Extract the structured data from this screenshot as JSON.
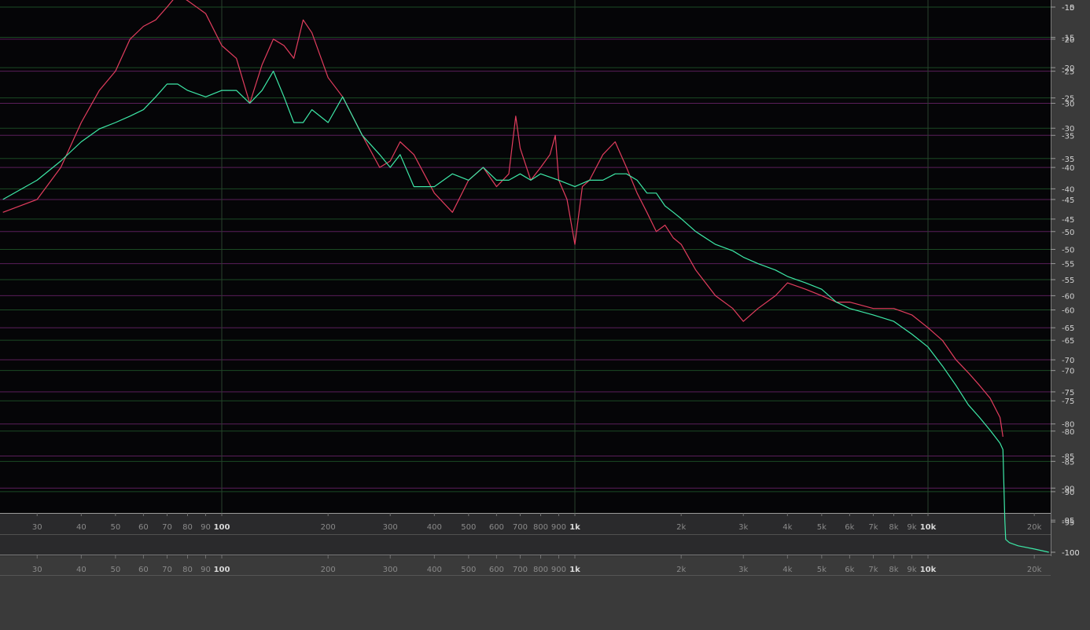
{
  "chart_data": {
    "type": "line",
    "xscale": "log",
    "xlim": [
      24,
      24000
    ],
    "grid": true,
    "legend": "none",
    "x_tick_labels": [
      "30",
      "40",
      "50",
      "60",
      "70",
      "80",
      "90",
      "100",
      "200",
      "300",
      "400",
      "500",
      "600",
      "700",
      "800",
      "900",
      "1k",
      "2k",
      "3k",
      "4k",
      "5k",
      "6k",
      "7k",
      "8k",
      "9k",
      "10k",
      "20k"
    ],
    "major_ticks": [
      "100",
      "1k",
      "10k"
    ],
    "left_scale": {
      "ylim": [
        -100,
        -15
      ],
      "labels": [
        "-15",
        "-20",
        "-25",
        "-30",
        "-35",
        "-40",
        "-45",
        "-50",
        "-55",
        "-60",
        "-65",
        "-70",
        "-75",
        "-80",
        "-85",
        "-90",
        "-95",
        "-100"
      ]
    },
    "right_scale": {
      "ylim": [
        -100,
        -10
      ],
      "labels": [
        "-10",
        "-15",
        "-20",
        "-25",
        "-30",
        "-35",
        "-40",
        "-45",
        "-50",
        "-55",
        "-60",
        "-65",
        "-70",
        "-75",
        "-80",
        "-85",
        "-90",
        "-95",
        "-100"
      ]
    },
    "series": [
      {
        "color": "#e23d5e",
        "points": [
          [
            24,
            -47
          ],
          [
            30,
            -45
          ],
          [
            35,
            -40
          ],
          [
            40,
            -33
          ],
          [
            45,
            -28
          ],
          [
            50,
            -25
          ],
          [
            55,
            -20
          ],
          [
            60,
            -18
          ],
          [
            65,
            -17
          ],
          [
            70,
            -15
          ],
          [
            75,
            -13
          ],
          [
            80,
            -14
          ],
          [
            90,
            -16
          ],
          [
            100,
            -21
          ],
          [
            110,
            -23
          ],
          [
            120,
            -30
          ],
          [
            130,
            -24
          ],
          [
            140,
            -20
          ],
          [
            150,
            -21
          ],
          [
            160,
            -23
          ],
          [
            170,
            -17
          ],
          [
            180,
            -19
          ],
          [
            200,
            -26
          ],
          [
            220,
            -29
          ],
          [
            250,
            -35
          ],
          [
            280,
            -40
          ],
          [
            300,
            -39
          ],
          [
            320,
            -36
          ],
          [
            350,
            -38
          ],
          [
            400,
            -44
          ],
          [
            450,
            -47
          ],
          [
            500,
            -42
          ],
          [
            550,
            -40
          ],
          [
            600,
            -43
          ],
          [
            650,
            -41
          ],
          [
            680,
            -32
          ],
          [
            700,
            -37
          ],
          [
            750,
            -42
          ],
          [
            800,
            -40
          ],
          [
            850,
            -38
          ],
          [
            880,
            -35
          ],
          [
            900,
            -42
          ],
          [
            950,
            -45
          ],
          [
            1000,
            -52
          ],
          [
            1050,
            -43
          ],
          [
            1100,
            -42
          ],
          [
            1200,
            -38
          ],
          [
            1300,
            -36
          ],
          [
            1400,
            -40
          ],
          [
            1500,
            -44
          ],
          [
            1600,
            -47
          ],
          [
            1700,
            -50
          ],
          [
            1800,
            -49
          ],
          [
            1900,
            -51
          ],
          [
            2000,
            -52
          ],
          [
            2200,
            -56
          ],
          [
            2500,
            -60
          ],
          [
            2800,
            -62
          ],
          [
            3000,
            -64
          ],
          [
            3300,
            -62
          ],
          [
            3700,
            -60
          ],
          [
            4000,
            -58
          ],
          [
            4500,
            -59
          ],
          [
            5000,
            -60
          ],
          [
            5500,
            -61
          ],
          [
            6000,
            -61
          ],
          [
            7000,
            -62
          ],
          [
            8000,
            -62
          ],
          [
            9000,
            -63
          ],
          [
            10000,
            -65
          ],
          [
            11000,
            -67
          ],
          [
            12000,
            -70
          ],
          [
            13000,
            -72
          ],
          [
            14000,
            -74
          ],
          [
            15000,
            -76
          ],
          [
            16000,
            -79
          ],
          [
            16300,
            -82
          ]
        ]
      },
      {
        "color": "#3de8a7",
        "points": [
          [
            24,
            -45
          ],
          [
            30,
            -42
          ],
          [
            35,
            -39
          ],
          [
            40,
            -36
          ],
          [
            45,
            -34
          ],
          [
            50,
            -33
          ],
          [
            55,
            -32
          ],
          [
            60,
            -31
          ],
          [
            65,
            -29
          ],
          [
            70,
            -27
          ],
          [
            75,
            -27
          ],
          [
            80,
            -28
          ],
          [
            90,
            -29
          ],
          [
            100,
            -28
          ],
          [
            110,
            -28
          ],
          [
            120,
            -30
          ],
          [
            130,
            -28
          ],
          [
            140,
            -25
          ],
          [
            150,
            -29
          ],
          [
            160,
            -33
          ],
          [
            170,
            -33
          ],
          [
            180,
            -31
          ],
          [
            200,
            -33
          ],
          [
            220,
            -29
          ],
          [
            250,
            -35
          ],
          [
            280,
            -38
          ],
          [
            300,
            -40
          ],
          [
            320,
            -38
          ],
          [
            350,
            -43
          ],
          [
            400,
            -43
          ],
          [
            450,
            -41
          ],
          [
            500,
            -42
          ],
          [
            550,
            -40
          ],
          [
            600,
            -42
          ],
          [
            650,
            -42
          ],
          [
            700,
            -41
          ],
          [
            750,
            -42
          ],
          [
            800,
            -41
          ],
          [
            900,
            -42
          ],
          [
            1000,
            -43
          ],
          [
            1100,
            -42
          ],
          [
            1200,
            -42
          ],
          [
            1300,
            -41
          ],
          [
            1400,
            -41
          ],
          [
            1500,
            -42
          ],
          [
            1600,
            -44
          ],
          [
            1700,
            -44
          ],
          [
            1800,
            -46
          ],
          [
            1900,
            -47
          ],
          [
            2000,
            -48
          ],
          [
            2200,
            -50
          ],
          [
            2500,
            -52
          ],
          [
            2800,
            -53
          ],
          [
            3000,
            -54
          ],
          [
            3300,
            -55
          ],
          [
            3700,
            -56
          ],
          [
            4000,
            -57
          ],
          [
            4500,
            -58
          ],
          [
            5000,
            -59
          ],
          [
            5500,
            -61
          ],
          [
            6000,
            -62
          ],
          [
            7000,
            -63
          ],
          [
            8000,
            -64
          ],
          [
            9000,
            -66
          ],
          [
            10000,
            -68
          ],
          [
            11000,
            -71
          ],
          [
            12000,
            -74
          ],
          [
            13000,
            -77
          ],
          [
            14000,
            -79
          ],
          [
            15000,
            -81
          ],
          [
            16000,
            -83
          ],
          [
            16300,
            -84
          ],
          [
            16500,
            -95
          ],
          [
            16600,
            -98
          ],
          [
            17000,
            -98.5
          ],
          [
            18000,
            -99
          ],
          [
            20000,
            -99.5
          ],
          [
            22000,
            -100
          ]
        ]
      }
    ]
  }
}
